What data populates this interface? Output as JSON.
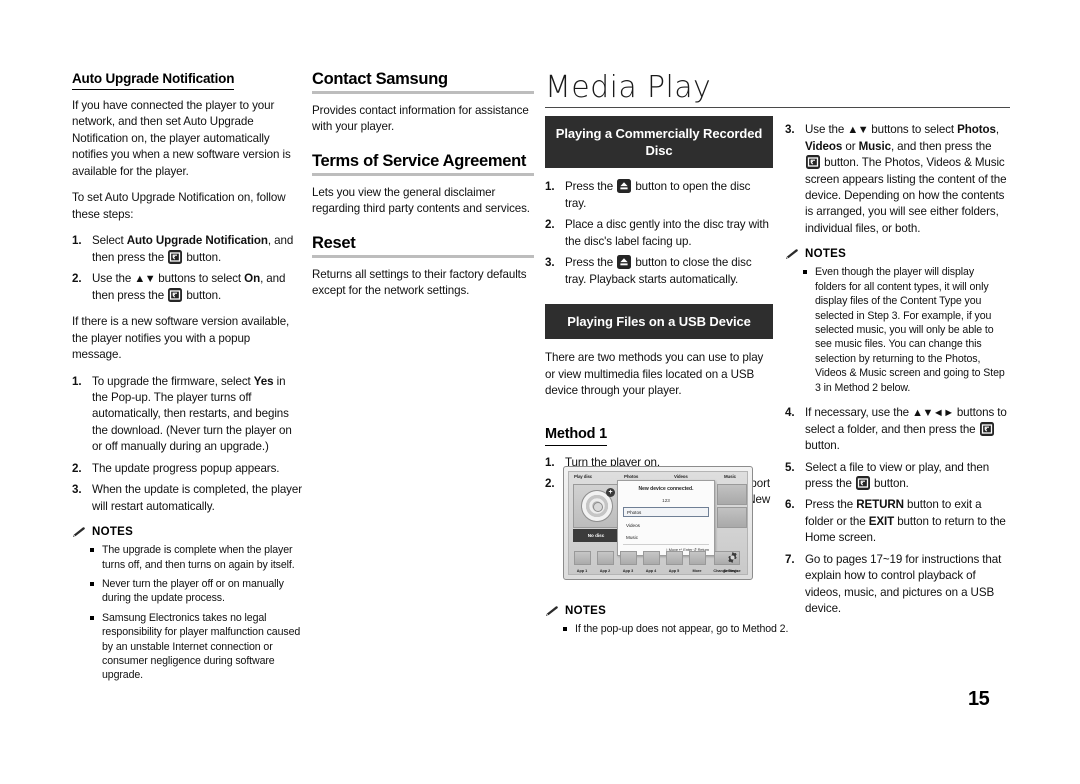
{
  "page": {
    "number": "15"
  },
  "title": {
    "main": "Media Play"
  },
  "icons": {
    "enter_button": "enter-button-icon",
    "eject_button": "eject-button-icon",
    "pencil": "pencil-icon",
    "gear": "gear-icon"
  },
  "col1": {
    "heading": "Auto Upgrade Notification",
    "p1": "If you have connected the player to your network, and then set Auto Upgrade Notification on, the player automatically notifies you when a new software version is available for the player.",
    "p2": "To set Auto Upgrade Notification on, follow these steps:",
    "steps_a": [
      {
        "num": "1.",
        "pre": "Select ",
        "bold": "Auto Upgrade Notification",
        "mid": ", and then press the ",
        "icon": "enter",
        "post": " button."
      },
      {
        "num": "2.",
        "pre": "Use the ",
        "arrows": "▲▼",
        "mid2": " buttons to select ",
        "bold": "On",
        "mid": ", and then press the ",
        "icon": "enter",
        "post": " button."
      }
    ],
    "p3": "If there is a new software version available, the player notifies you with a popup message.",
    "steps_b": [
      {
        "num": "1.",
        "pre": "To upgrade the firmware, select ",
        "bold": "Yes",
        "post": " in the Pop-up. The player turns off automatically, then restarts, and begins the download. (Never turn the player on or off manually during an upgrade.)"
      },
      {
        "num": "2.",
        "pre": "The update progress popup appears."
      },
      {
        "num": "3.",
        "pre": "When the update is completed, the player will restart automatically."
      }
    ],
    "notes_label": "NOTES",
    "notes": [
      "The upgrade is complete when the player turns off, and then turns on again by itself.",
      "Never turn the player off or on manually during the update process.",
      "Samsung Electronics takes no legal responsibility for player malfunction caused by an unstable Internet connection or consumer negligence during software upgrade."
    ]
  },
  "col2": {
    "sections": [
      {
        "heading": "Contact Samsung",
        "body": "Provides contact information for assistance with your player."
      },
      {
        "heading": "Terms of Service Agreement",
        "body": "Lets you view the general disclaimer regarding third party contents and services."
      },
      {
        "heading": "Reset",
        "body": "Returns all settings to their factory defaults except for the network settings."
      }
    ]
  },
  "col3": {
    "banner1_line1": "Playing a Commercially Recorded",
    "banner1_line2": "Disc",
    "steps_disc": [
      {
        "num": "1.",
        "pre": "Press the ",
        "icon": "eject",
        "post": " button to open the disc tray."
      },
      {
        "num": "2.",
        "pre": "Place a disc gently into the disc tray with the disc's label facing up."
      },
      {
        "num": "3.",
        "pre": "Press the ",
        "icon": "eject",
        "post": " button to close the disc tray. Playback starts automatically."
      }
    ],
    "banner2": "Playing Files on a USB Device",
    "usb_intro": "There are two methods you can use to play or view multimedia files located on a USB device through your player.",
    "method_heading": "Method 1",
    "steps_method": [
      {
        "num": "1.",
        "pre": "Turn the player on."
      },
      {
        "num": "2.",
        "pre": "Connect the USB device to the USB port on the front panel of the player. The New Device Connected pop-up appears."
      }
    ],
    "notes_label": "NOTES",
    "notes": [
      "If the pop-up does not appear, go to Method 2."
    ]
  },
  "tv": {
    "top_labels": [
      "Play disc",
      "Photos",
      "Videos",
      "Music"
    ],
    "no_disc": "No disc",
    "popup_title": "New device connected.",
    "popup_sub": "123",
    "popup_items": [
      "Photos",
      "Videos",
      "Music"
    ],
    "popup_footer": "↕ Move    ↵ Enter    ↺ Return",
    "app_labels": [
      "App 1",
      "App 2",
      "App 3",
      "App 4",
      "App 5",
      "More"
    ],
    "change_device": "Change Device",
    "settings": "Settings"
  },
  "col4": {
    "steps": [
      {
        "num": "3.",
        "pre": "Use the ",
        "arrows": "▲▼",
        "mid2": " buttons to select ",
        "bold1": "Photos",
        "mid3": ", ",
        "bold2": "Videos",
        "mid4": " or ",
        "bold3": "Music",
        "mid5": ", and then press the ",
        "icon": "enter",
        "post": " button. The Photos, Videos & Music screen appears listing the content of the device. Depending on how the contents is arranged, you will see either folders, individual files, or both."
      },
      {
        "num": "4.",
        "pre": "If necessary, use the ",
        "arrows": "▲▼◄►",
        "mid2": " buttons to select a folder, and then press the ",
        "icon": "enter",
        "post": " button."
      },
      {
        "num": "5.",
        "pre": "Select a file to view or play, and then press the ",
        "icon": "enter",
        "post": " button."
      },
      {
        "num": "6.",
        "pre": "Press the ",
        "bold1": "RETURN",
        "mid3": " button to exit a folder or the ",
        "bold2": "EXIT",
        "post": " button to return to the Home screen."
      },
      {
        "num": "7.",
        "pre": "Go to pages 17~19 for instructions that explain how to control playback of videos, music, and pictures on a USB device."
      }
    ],
    "notes_label": "NOTES",
    "notes": [
      "Even though the player will display folders for all content types, it will only display files of the Content Type you selected in Step 3. For example, if you selected music, you will only be able to see music files. You can change this selection by returning to the Photos, Videos & Music screen and going to Step 3 in Method 2 below."
    ]
  }
}
